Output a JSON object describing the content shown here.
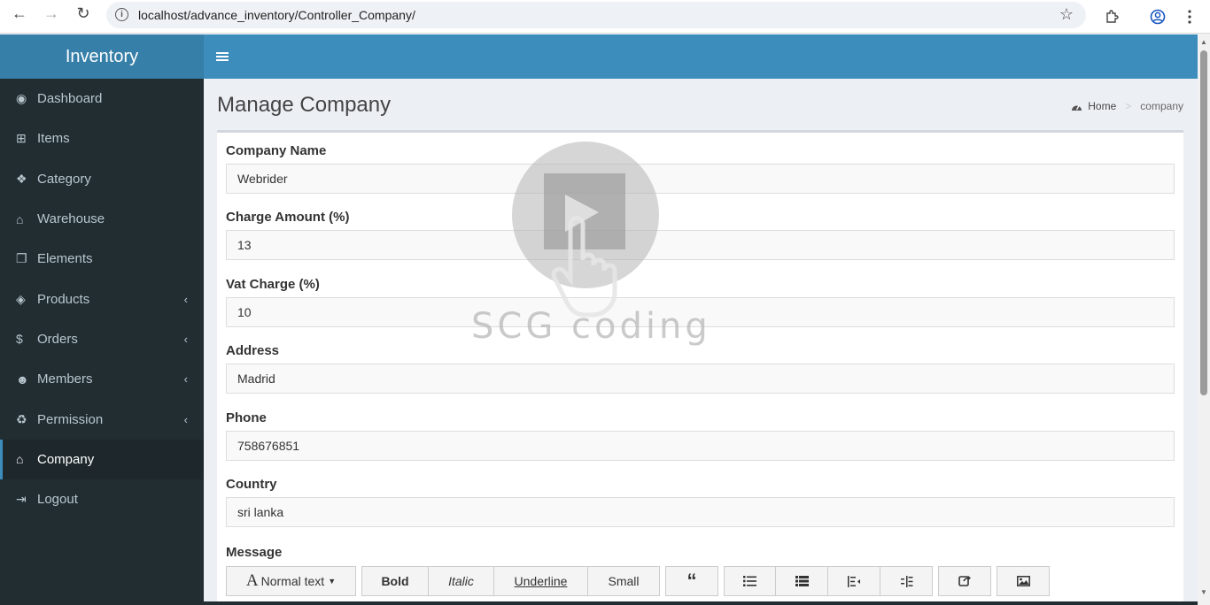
{
  "browser": {
    "url": "localhost/advance_inventory/Controller_Company/",
    "back_icon": "←",
    "forward_icon": "→",
    "reload_icon": "↻"
  },
  "sidebar": {
    "brand": "Inventory",
    "items": [
      {
        "label": "Dashboard",
        "icon": "dashboard-icon",
        "glyph": "◉"
      },
      {
        "label": "Items",
        "icon": "cart-icon",
        "glyph": "⊞"
      },
      {
        "label": "Category",
        "icon": "cubes-icon",
        "glyph": "❖"
      },
      {
        "label": "Warehouse",
        "icon": "bank-icon",
        "glyph": "⌂"
      },
      {
        "label": "Elements",
        "icon": "copy-icon",
        "glyph": "❐"
      },
      {
        "label": "Products",
        "icon": "cube-icon",
        "glyph": "◈",
        "chevron": "‹"
      },
      {
        "label": "Orders",
        "icon": "dollar-icon",
        "glyph": "$",
        "chevron": "‹"
      },
      {
        "label": "Members",
        "icon": "users-icon",
        "glyph": "☻",
        "chevron": "‹"
      },
      {
        "label": "Permission",
        "icon": "recycle-icon",
        "glyph": "♻",
        "chevron": "‹"
      },
      {
        "label": "Company",
        "icon": "bank-icon",
        "glyph": "⌂",
        "active": true
      },
      {
        "label": "Logout",
        "icon": "sign-out-icon",
        "glyph": "⇥"
      }
    ]
  },
  "page": {
    "title": "Manage Company",
    "breadcrumb": {
      "home": "Home",
      "separator": ">",
      "current": "company"
    }
  },
  "form": {
    "fields": [
      {
        "label": "Company Name",
        "value": "Webrider"
      },
      {
        "label": "Charge Amount (%)",
        "value": "13"
      },
      {
        "label": "Vat Charge (%)",
        "value": "10"
      },
      {
        "label": "Address",
        "value": "Madrid"
      },
      {
        "label": "Phone",
        "value": "758676851"
      },
      {
        "label": "Country",
        "value": "sri lanka"
      }
    ],
    "message_label": "Message",
    "toolbar": {
      "normal_text": "Normal text",
      "bold": "Bold",
      "italic": "Italic",
      "underline": "Underline",
      "small": "Small"
    }
  },
  "watermark": {
    "text": "SCG coding"
  },
  "colors": {
    "header": "#3c8dbc",
    "brand": "#367fa9",
    "sidebar": "#222d32"
  }
}
